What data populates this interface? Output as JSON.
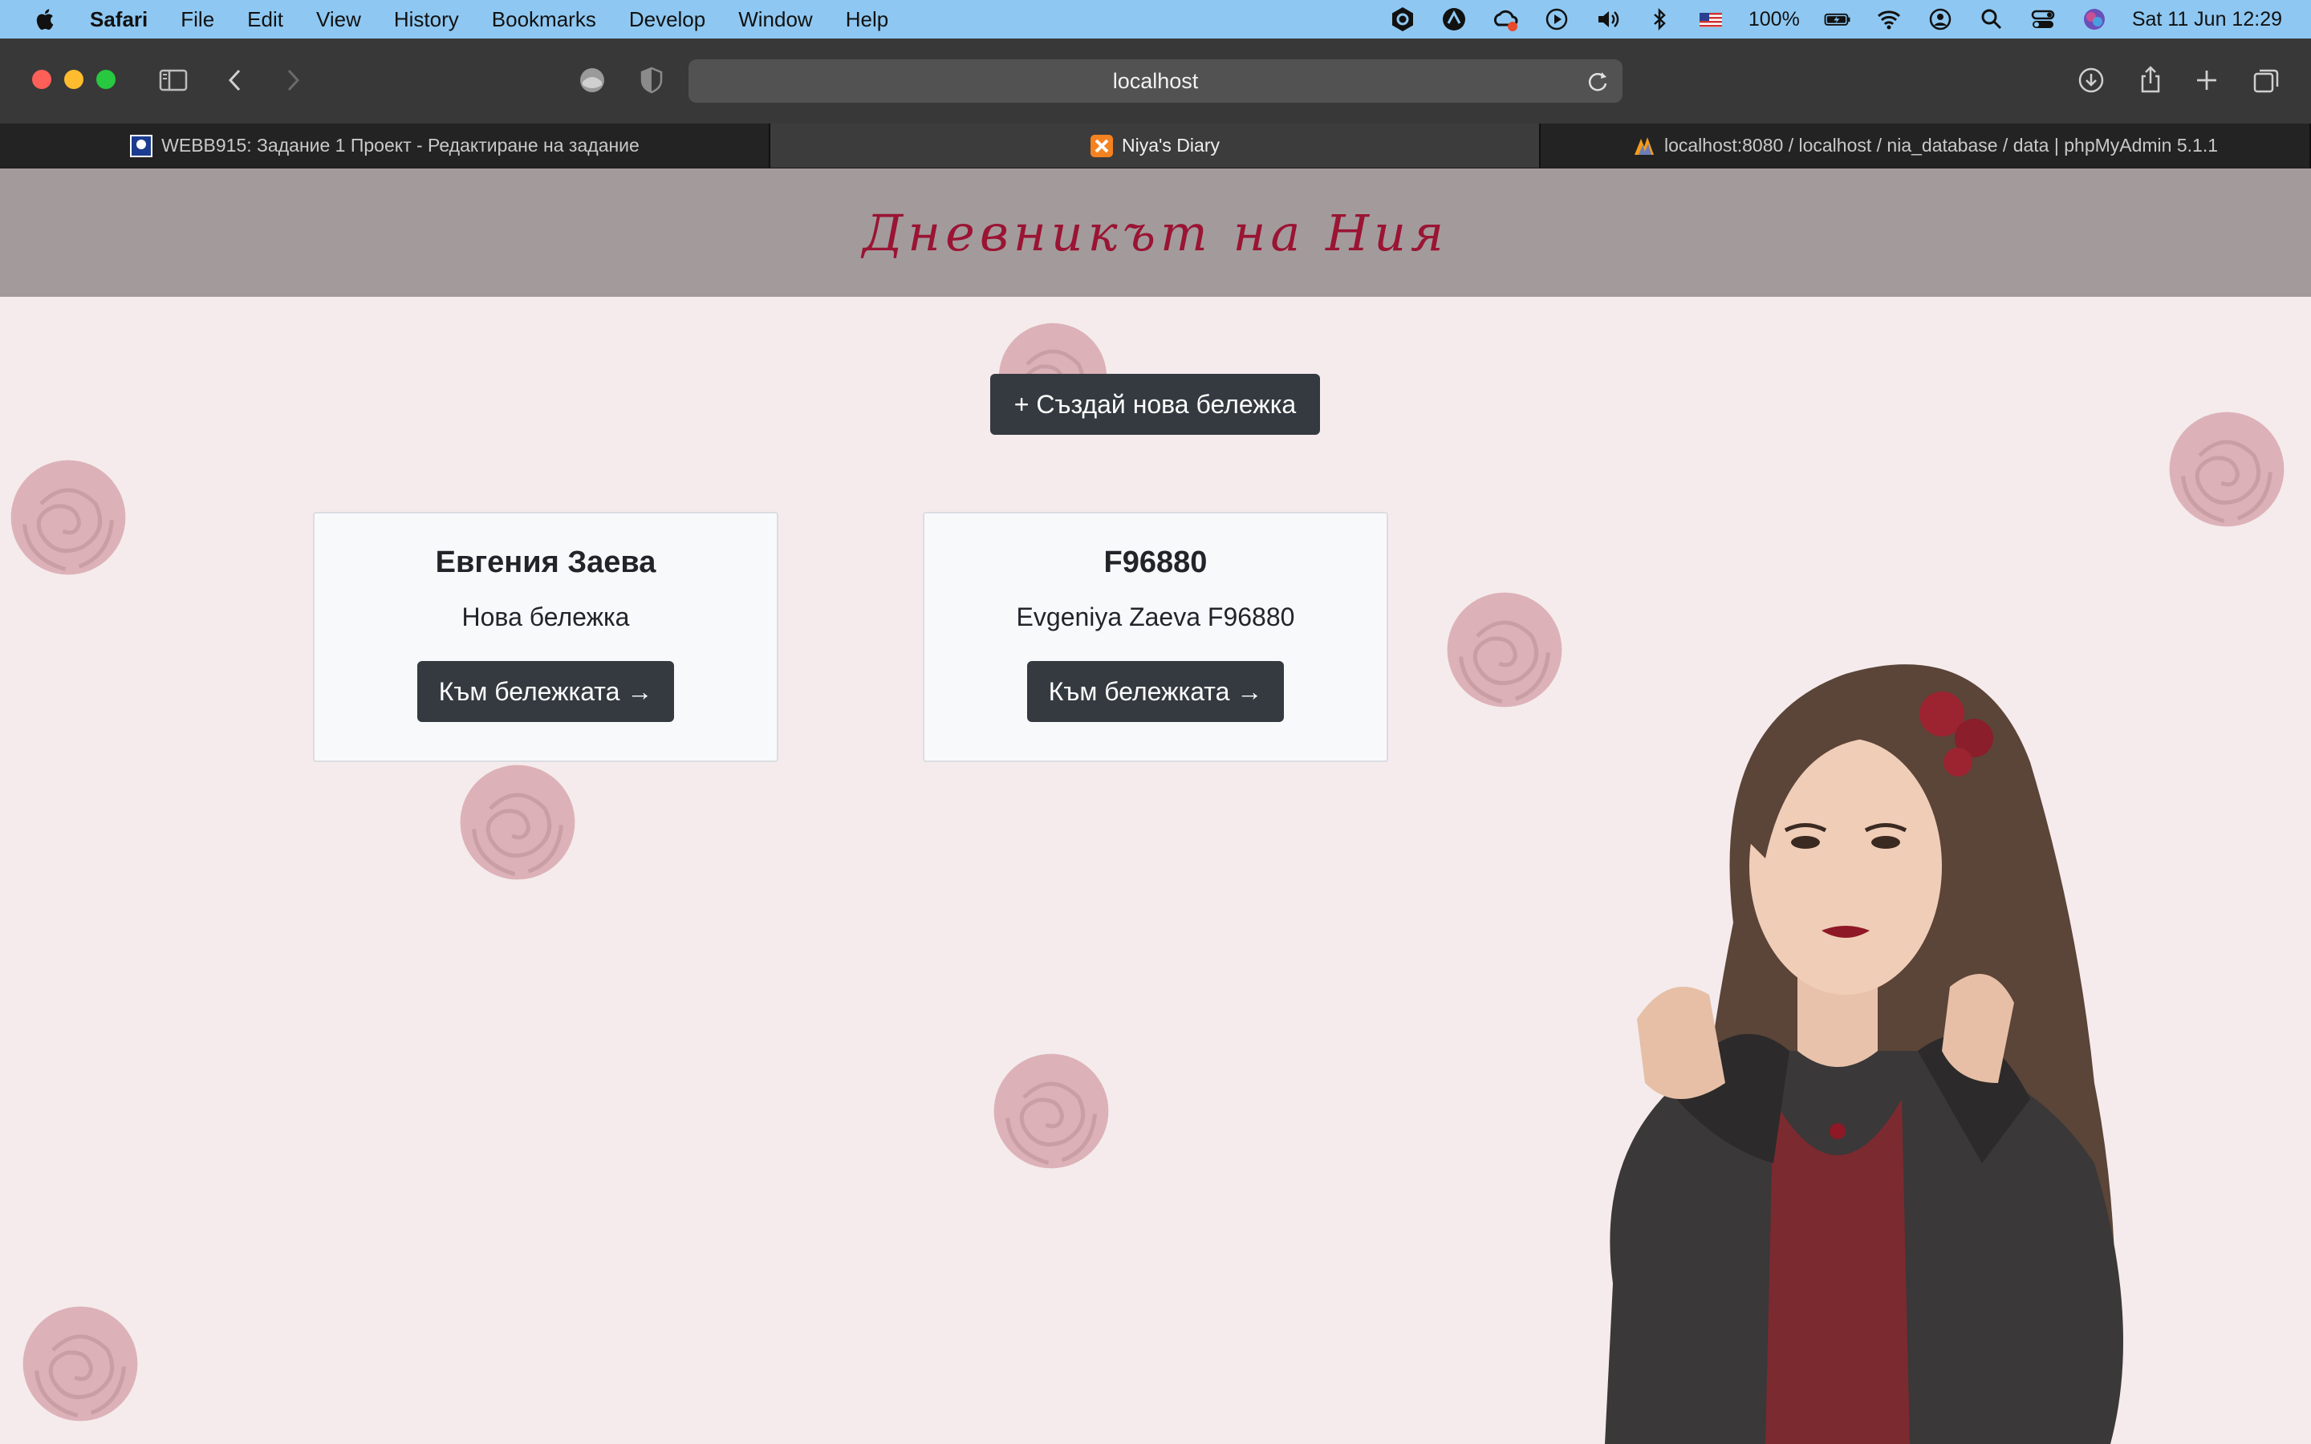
{
  "menubar": {
    "app_name": "Safari",
    "items": [
      "File",
      "Edit",
      "View",
      "History",
      "Bookmarks",
      "Develop",
      "Window",
      "Help"
    ],
    "battery": "100%",
    "datetime": "Sat 11 Jun  12:29"
  },
  "toolbar": {
    "url": "localhost"
  },
  "tabs": [
    {
      "label": "WEBB915: Задание 1 Проект - Редактиране на задание",
      "active": false
    },
    {
      "label": "Niya's Diary",
      "active": true
    },
    {
      "label": "localhost:8080 / localhost / nia_database / data | phpMyAdmin 5.1.1",
      "active": false
    }
  ],
  "page": {
    "site_title": "Дневникът на Ния",
    "create_button": "+ Създай нова бележка",
    "notes": [
      {
        "title": "Евгения Заева",
        "text": "Нова бележка",
        "button": "Към бележката →"
      },
      {
        "title": "F96880",
        "text": "Evgeniya Zaeva F96880",
        "button": "Към бележката →"
      }
    ]
  },
  "colors": {
    "menubar_bg": "#8ec8f2",
    "toolbar_bg": "#383838",
    "header_bg": "#a39b9b",
    "title_color": "#9a1434",
    "page_bg": "#f5ebec",
    "button_bg": "#343a40"
  }
}
